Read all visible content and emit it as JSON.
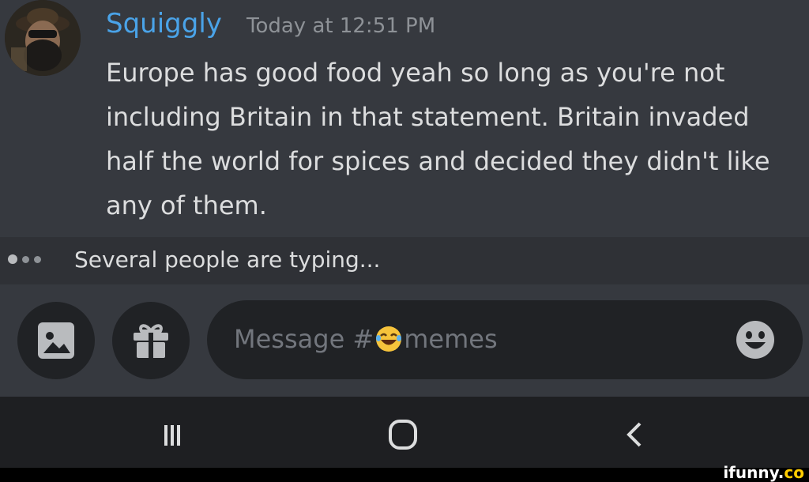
{
  "message": {
    "username": "Squiggly",
    "timestamp": "Today at 12:51 PM",
    "text": "Europe has good food yeah so long as you're not including Britain in that statement. Britain invaded half the world for spices and decided they didn't like any of them."
  },
  "typing": {
    "text": "Several people are typing..."
  },
  "composer": {
    "placeholder_prefix": "Message #",
    "placeholder_suffix": "memes",
    "channel_emoji": "😂"
  },
  "watermark": {
    "text": "ifunny.",
    "suffix": "co"
  },
  "colors": {
    "username": "#4aa3e8",
    "background": "#36393f",
    "input_bg": "#202225"
  },
  "icons": [
    "image-upload-icon",
    "gift-icon",
    "emoji-picker-icon",
    "recent-apps-icon",
    "home-icon",
    "back-icon"
  ]
}
